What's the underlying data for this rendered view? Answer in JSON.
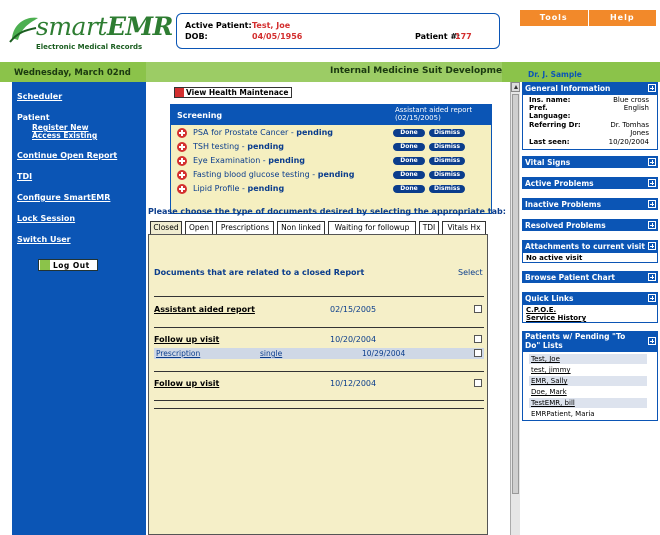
{
  "app": {
    "name_prefix": "smart",
    "name_suffix": "EMR",
    "tagline": "Electronic Medical Records"
  },
  "patient": {
    "active_label": "Active Patient:",
    "active_name": "Test, Joe",
    "dob_label": "DOB:",
    "dob": "04/05/1956",
    "num_label": "Patient #:",
    "num": "177"
  },
  "top_actions": [
    "Tools",
    "Help"
  ],
  "date": "Wednesday, March 02nd",
  "suite_title": "Internal Medicine Suit Development",
  "doctor": "Dr. J. Sample",
  "nav": {
    "scheduler": "Scheduler",
    "patient": "Patient",
    "register_new": "Register New",
    "access_existing": "Access Existing",
    "continue_open_report": "Continue Open Report",
    "tdi": "TDI",
    "configure": "Configure SmartEMR",
    "lock_session": "Lock Session",
    "switch_user": "Switch User",
    "logout": "Log Out"
  },
  "health_maintenance_button": "View Health Maintenace",
  "screening": {
    "title": "Screening",
    "note_line1": "Assistant aided report",
    "note_line2": "(02/15/2005)",
    "done_label": "Done",
    "dismiss_label": "Dismiss",
    "items": [
      {
        "name": "PSA for Prostate Cancer",
        "status": "pending"
      },
      {
        "name": "TSH testing",
        "status": "pending"
      },
      {
        "name": "Eye Examination",
        "status": "pending"
      },
      {
        "name": "Fasting blood glucose testing",
        "status": "pending"
      },
      {
        "name": "Lipid Profile",
        "status": "pending"
      }
    ],
    "separator": " - "
  },
  "choose_text": "Please choose the type of documents desired by selecting the appropriate tab:",
  "tabs": [
    "Closed",
    "Open",
    "Prescriptions",
    "Non linked",
    "Waiting for followup",
    "TDI",
    "Vitals Hx"
  ],
  "documents": {
    "header": "Documents that are related to a closed Report",
    "select_label": "Select",
    "rows": [
      {
        "title": "Assistant aided report",
        "date": "02/15/2005"
      },
      {
        "title": "Follow up visit",
        "date": "10/20/2004"
      },
      {
        "title": "Follow up visit",
        "date": "10/12/2004"
      }
    ],
    "sub_row": {
      "type": "Prescription",
      "kind": "single",
      "date": "10/29/2004"
    }
  },
  "right": {
    "general_info_title": "General Information",
    "general_info": [
      {
        "label": "Ins. name:",
        "value": "Blue cross"
      },
      {
        "label": "Pref.",
        "value": "English"
      },
      {
        "label": "Language:",
        "value": ""
      },
      {
        "label": "Referring Dr:",
        "value": "Dr. Tomhas"
      },
      {
        "label": "",
        "value": "Jones"
      },
      {
        "label": "Last seen:",
        "value": "10/20/2004"
      }
    ],
    "sections": {
      "vital_signs": "Vital Signs",
      "active_problems": "Active Problems",
      "inactive_problems": "Inactive Problems",
      "resolved_problems": "Resolved Problems",
      "attachments": "Attachments to current visit",
      "attachments_value": "No active visit",
      "browse_chart": "Browse Patient Chart",
      "quick_links": "Quick Links",
      "quick_links_items": [
        "C.P.O.E.",
        "Service History"
      ],
      "todo_title_1": "Patients w/ Pending \"To",
      "todo_title_2": "Do\" Lists",
      "todo_patients": [
        "Test, Joe",
        "test, jimmy",
        "EMR, Sally",
        "Doe, Mark",
        "TestEMR, bill",
        "EMRPatient, Maria"
      ]
    }
  },
  "colors": {
    "primary_blue": "#0b55b5",
    "brand_green": "#8bc34a",
    "alert_red": "#d32f2f",
    "action_orange": "#f2892a",
    "panel_cream": "#f5efc8"
  }
}
